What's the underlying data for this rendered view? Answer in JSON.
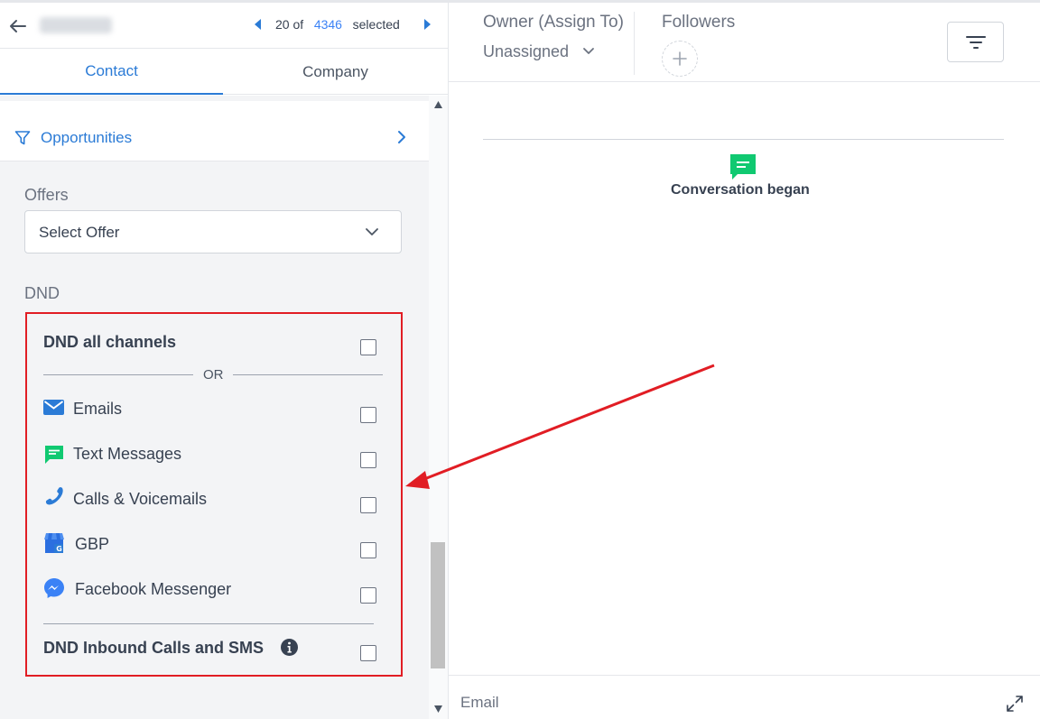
{
  "header": {
    "nav_count": "20 of",
    "nav_total": "4346",
    "nav_selected": "selected"
  },
  "tabs": [
    {
      "label": "Contact",
      "active": true
    },
    {
      "label": "Company",
      "active": false
    }
  ],
  "opportunities": {
    "label": "Opportunities",
    "icon": "filter-icon"
  },
  "offers": {
    "label": "Offers",
    "select_value": "Select Offer"
  },
  "dnd": {
    "section_label": "DND",
    "all_channels_label": "DND all channels",
    "or_label": "OR",
    "channels": [
      {
        "label": "Emails",
        "icon": "email-icon",
        "checked": false
      },
      {
        "label": "Text Messages",
        "icon": "chat-icon",
        "checked": false
      },
      {
        "label": "Calls & Voicemails",
        "icon": "phone-icon",
        "checked": false
      },
      {
        "label": "GBP",
        "icon": "gbp-store-icon",
        "checked": false
      },
      {
        "label": "Facebook Messenger",
        "icon": "messenger-icon",
        "checked": false
      }
    ],
    "inbound_label": "DND Inbound Calls and SMS"
  },
  "right": {
    "owner_label": "Owner (Assign To)",
    "owner_value": "Unassigned",
    "followers_label": "Followers",
    "conversation_text": "Conversation began",
    "composer_channel": "Email"
  },
  "colors": {
    "accent": "#2b7bd6",
    "annotation": "#e11d24",
    "chat_green": "#10c971"
  }
}
